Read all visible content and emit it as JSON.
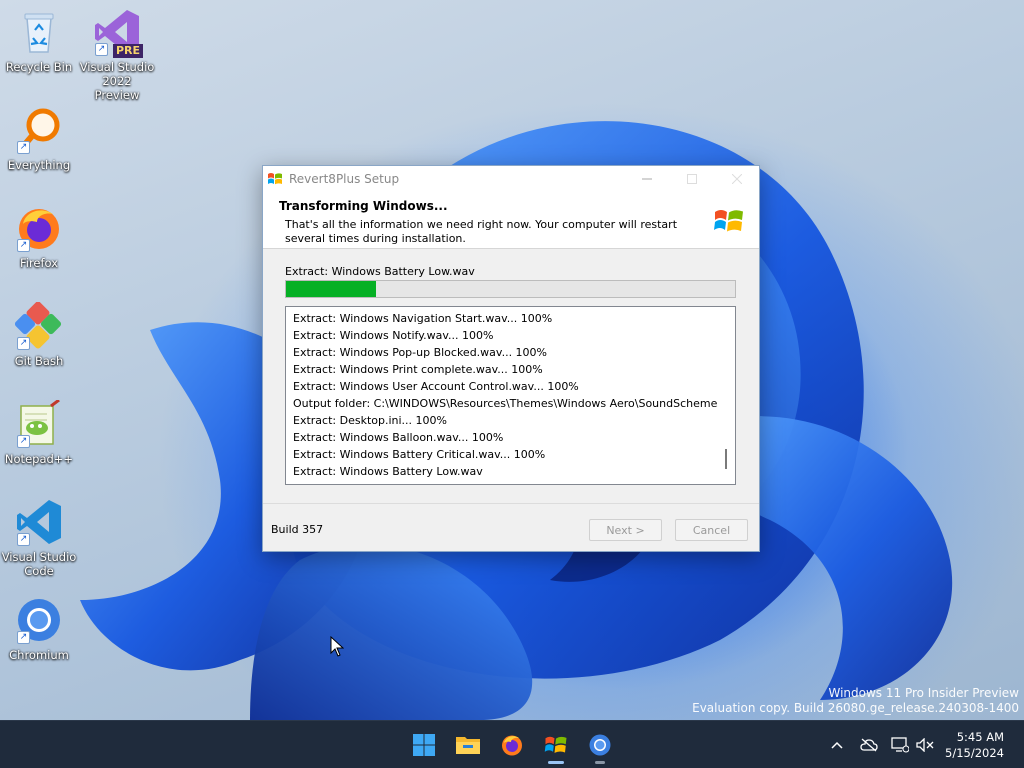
{
  "desktop": {
    "icons": [
      {
        "label": "Recycle Bin"
      },
      {
        "label": "Visual Studio 2022 Preview",
        "badge": "PRE"
      },
      {
        "label": "Everything"
      },
      {
        "label": "Firefox"
      },
      {
        "label": "Git Bash"
      },
      {
        "label": "Notepad++"
      },
      {
        "label": "Visual Studio Code"
      },
      {
        "label": "Chromium"
      }
    ],
    "watermark": {
      "line1": "Windows 11 Pro Insider Preview",
      "line2": "Evaluation copy. Build 26080.ge_release.240308-1400"
    }
  },
  "setup": {
    "window_title": "Revert8Plus Setup",
    "header_title": "Transforming Windows...",
    "header_subtitle": "That's all the information we need right now. Your computer will restart several times during installation.",
    "status": "Extract: Windows Battery Low.wav",
    "progress": 0.2,
    "log": [
      "Extract: Windows Navigation Start.wav... 100%",
      "Extract: Windows Notify.wav... 100%",
      "Extract: Windows Pop-up Blocked.wav... 100%",
      "Extract: Windows Print complete.wav... 100%",
      "Extract: Windows User Account Control.wav... 100%",
      "Output folder: C:\\WINDOWS\\Resources\\Themes\\Windows Aero\\SoundSchemes\\Gar...",
      "Extract: Desktop.ini... 100%",
      "Extract: Windows Balloon.wav... 100%",
      "Extract: Windows Battery Critical.wav... 100%",
      "Extract: Windows Battery Low.wav"
    ],
    "build": "Build 357",
    "next_label": "Next >",
    "cancel_label": "Cancel"
  },
  "taskbar": {
    "apps": [
      "start-icon",
      "file-explorer-icon",
      "firefox-icon",
      "revert8plus-setup-icon",
      "chromium-icon"
    ],
    "clock_time": "5:45 AM",
    "clock_date": "5/15/2024"
  },
  "colors": {
    "progress_fill": "#06b025",
    "taskbar": "#1f2b3c"
  }
}
